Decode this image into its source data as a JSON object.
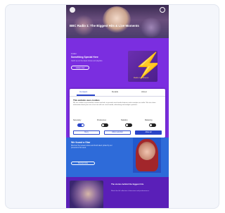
{
  "hero": {
    "title": "BBC Radio 1: The Biggest Hits & Live Moments"
  },
  "promo": {
    "kicker": "Listen",
    "heading": "Something Special Here",
    "text": "Catch up on the latest shows and playlists",
    "button": "Listen now",
    "artwork_tag": "Radio 1 Anthems"
  },
  "consent": {
    "tabs": [
      "Consent",
      "Details",
      "About"
    ],
    "active_tab": "Consent",
    "heading": "This website uses cookies",
    "body": "We use cookies to personalise content and ads, to provide social media features and to analyse our traffic. We also share information about your use of our site with our social media, advertising and analytics partners.",
    "toggles": [
      {
        "label": "Necessary",
        "state": "on"
      },
      {
        "label": "Preferences",
        "state": "off"
      },
      {
        "label": "Statistics",
        "state": "off"
      },
      {
        "label": "Marketing",
        "state": "off"
      }
    ],
    "buttons": {
      "deny": "Deny",
      "allow_selection": "Allow selection",
      "allow_all": "Allow all"
    }
  },
  "section2": {
    "title": "We found a Star",
    "text": "Discover the newest voices and fresh talent picked by our presenters this week.",
    "button": "Find out more"
  },
  "section3": {
    "title": "The stories behind the biggest hits",
    "text": "Watch the full collection of interviews and performances."
  },
  "colors": {
    "brand_purple": "#7b2ee0",
    "accent_blue": "#2a45c8",
    "section_blue": "#2e6bd9"
  }
}
